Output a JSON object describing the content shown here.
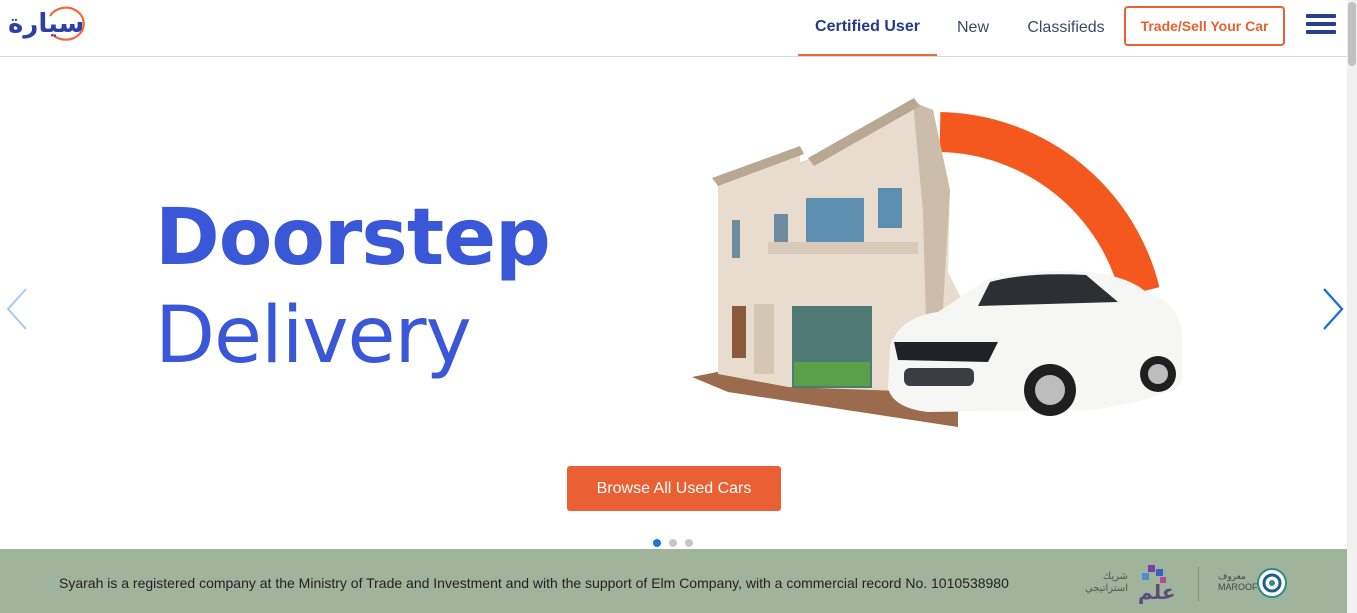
{
  "header": {
    "logo_text": "سيارة",
    "nav": [
      {
        "label": "Certified User",
        "active": true
      },
      {
        "label": "New",
        "active": false
      },
      {
        "label": "Classifieds",
        "active": false
      }
    ],
    "cta_label": "Trade/Sell Your Car"
  },
  "hero": {
    "title_line1": "Doorstep",
    "title_line2": "Delivery",
    "browse_label": "Browse All Used Cars",
    "slides_count": 3,
    "active_slide": 1
  },
  "footer": {
    "text": "Syarah is a registered company at the Ministry of Trade and Investment and with the support of Elm Company, with a commercial record No. 1010538980",
    "partner_label": "شريك استراتيجي",
    "maroof_label_ar": "معروف",
    "maroof_label_en": "MAROOF"
  },
  "colors": {
    "brand_blue": "#3a57d8",
    "brand_orange": "#ea6034",
    "active_dot": "#1f75d6",
    "footer_bg": "#9fb49b"
  },
  "icons": [
    "chevron-left-icon",
    "chevron-right-icon",
    "hamburger-menu-icon",
    "elm-logo-icon",
    "maroof-logo-icon"
  ]
}
